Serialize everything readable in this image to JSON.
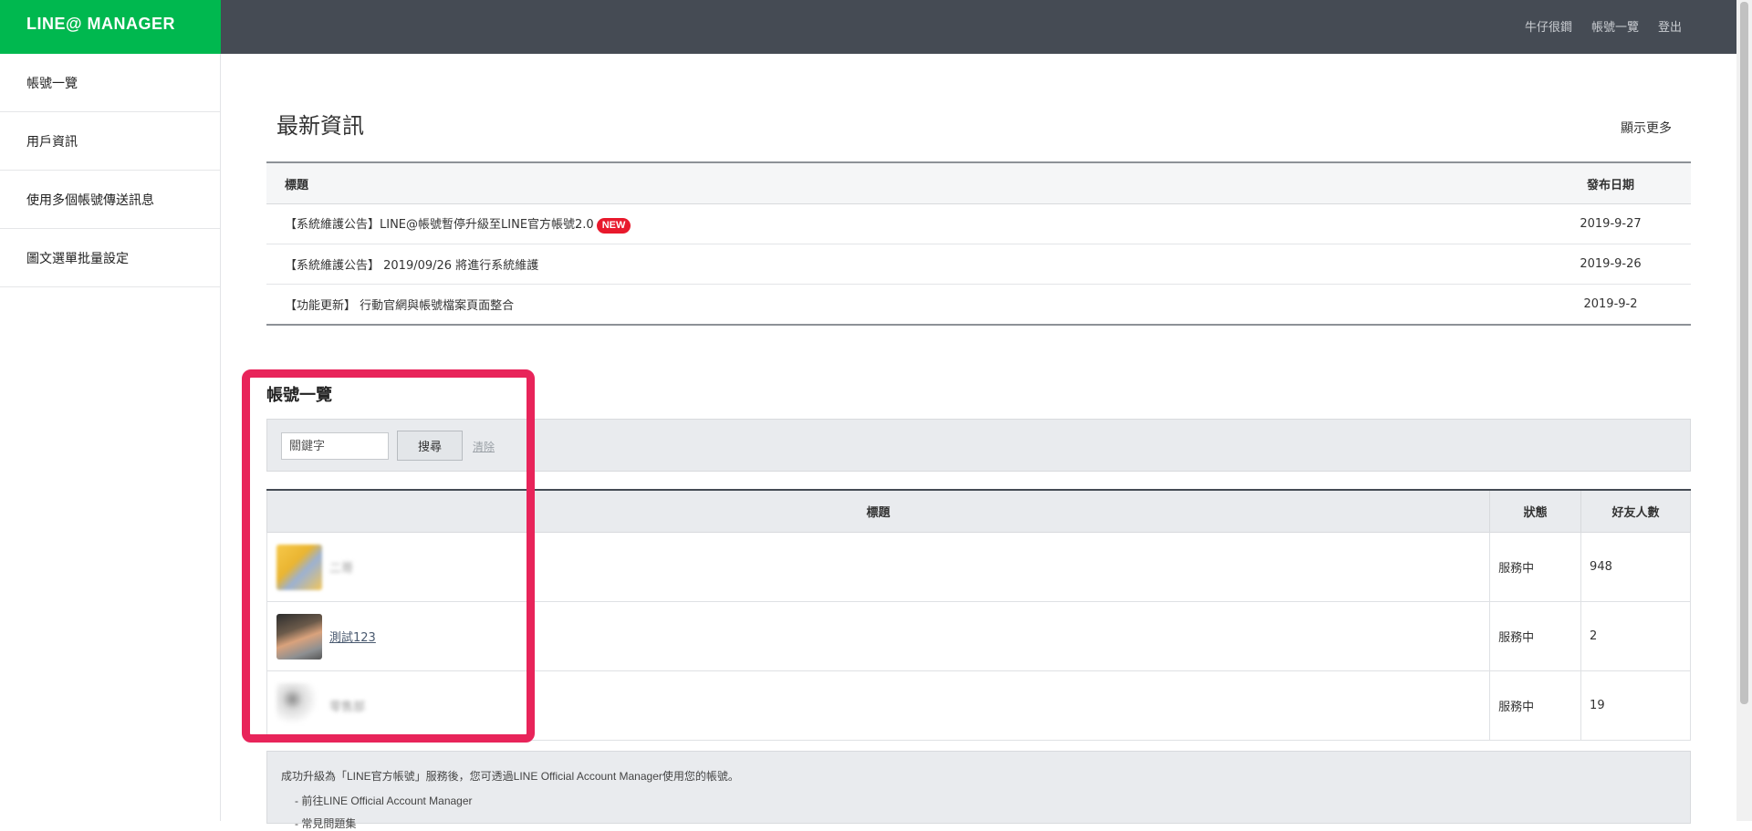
{
  "brand": "LINE@ MANAGER",
  "topnav": {
    "user": "牛仔很鐧",
    "accounts": "帳號一覽",
    "logout": "登出"
  },
  "sidebar": {
    "items": [
      {
        "label": "帳號一覽"
      },
      {
        "label": "用戶資訊"
      },
      {
        "label": "使用多個帳號傳送訊息"
      },
      {
        "label": "圖文選單批量設定"
      }
    ]
  },
  "news": {
    "title": "最新資訊",
    "show_more": "顯示更多",
    "headers": {
      "title": "標題",
      "date": "發布日期"
    },
    "items": [
      {
        "title": "【系統維護公告】LINE@帳號暫停升級至LINE官方帳號2.0",
        "badge": "NEW",
        "date": "2019-9-27"
      },
      {
        "title": "【系統維護公告】 2019/09/26 將進行系統維護",
        "date": "2019-9-26"
      },
      {
        "title": "【功能更新】 行動官網與帳號檔案頁面整合",
        "date": "2019-9-2"
      }
    ]
  },
  "accounts": {
    "title": "帳號一覽",
    "search": {
      "placeholder": "關鍵字",
      "button": "搜尋",
      "clear": "清除"
    },
    "headers": {
      "title": "標題",
      "status": "狀態",
      "friends": "好友人數"
    },
    "rows": [
      {
        "name": "二哥",
        "status": "服務中",
        "friends": "948"
      },
      {
        "name": "測試123",
        "status": "服務中",
        "friends": "2"
      },
      {
        "name": "零售部",
        "status": "服務中",
        "friends": "19"
      }
    ]
  },
  "info": {
    "line1": "成功升級為「LINE官方帳號」服務後，您可透過LINE Official Account Manager使用您的帳號。",
    "line2": "- 前往LINE Official Account Manager",
    "line3": "- 常見問題集"
  },
  "colors": {
    "brand_green": "#00b84f",
    "topbar": "#454b54",
    "highlight": "#e8245a",
    "new_badge": "#e8192c"
  }
}
